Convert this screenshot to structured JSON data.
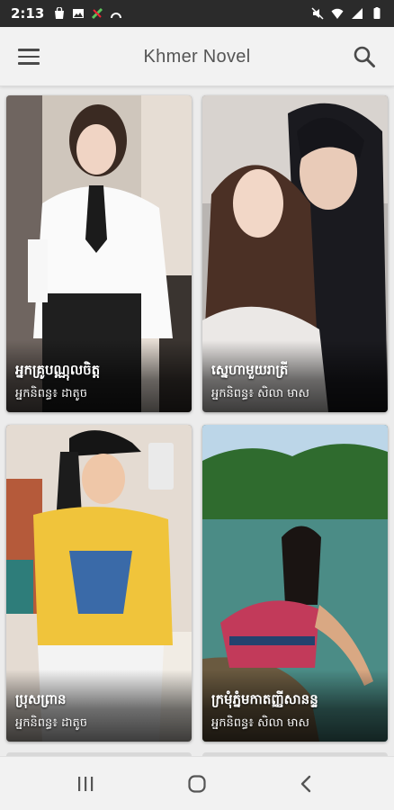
{
  "status_bar": {
    "time": "2:13",
    "left_icons": [
      "shopping-bag-icon",
      "image-icon",
      "app-icon",
      "arc-icon"
    ],
    "right_icons": [
      "mute-icon",
      "wifi-icon",
      "signal-icon",
      "battery-icon"
    ]
  },
  "app_bar": {
    "title": "Khmer Novel",
    "menu_icon": "hamburger-menu-icon",
    "search_icon": "search-icon"
  },
  "novels": [
    {
      "title": "អ្នកគ្រូបណ្ណុលចិត្ត",
      "author": "អ្នកនិពន្ធ៖ ដាតូច",
      "cover": "woman-white-shirt-tie"
    },
    {
      "title": "ស្នេហាមួយរាត្រី",
      "author": "អ្នកនិពន្ធ៖ សិលា មាស",
      "cover": "illustrated-couple"
    },
    {
      "title": "ប្រុសព្រាន",
      "author": "អ្នកនិពន្ធ៖ ដាតូច",
      "cover": "woman-yellow-shirt-selfie"
    },
    {
      "title": "ក្រមុំភ្នំមកាតញ្ញីសានន្ទ",
      "author": "អ្នកនិពន្ធ៖ សិលា មាស",
      "cover": "woman-by-lake"
    }
  ],
  "nav_bar": {
    "icons": [
      "recent-apps-icon",
      "home-icon",
      "back-icon"
    ]
  },
  "colors": {
    "status_bar": "#2b2b2b",
    "app_bar": "#f2f2f2",
    "background": "#ececec",
    "icon": "#4a4a4a"
  }
}
